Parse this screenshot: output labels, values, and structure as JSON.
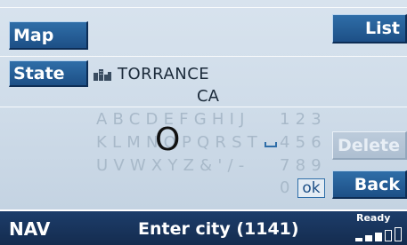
{
  "buttons": {
    "map": "Map",
    "state": "State",
    "list": "List",
    "delete": "Delete",
    "back": "Back"
  },
  "entry": {
    "city": "TORRANCE",
    "state": "CA",
    "city_icon": "city-skyline-icon"
  },
  "keyboard": {
    "row1": "ABCDEFGHIJ",
    "row1_digits": "123",
    "row2": "KLMNOPQRST",
    "row2_digits": "456",
    "row3": "UVWXYZ&'/-",
    "row3_digits": "789",
    "row4_digit": "0",
    "ok_label": "ok",
    "selected_char": "O",
    "space_icon": "space-bar-icon"
  },
  "status_bar": {
    "mode": "NAV",
    "prompt": "Enter city (1141)",
    "status": "Ready",
    "signal_icon": "signal-strength-icon",
    "signal_level": "3/5"
  },
  "colors": {
    "button_blue": "#1d4f86",
    "status_bar": "#142c4f",
    "background": "#cfdce9",
    "inactive_text": "#a8b9c9"
  }
}
